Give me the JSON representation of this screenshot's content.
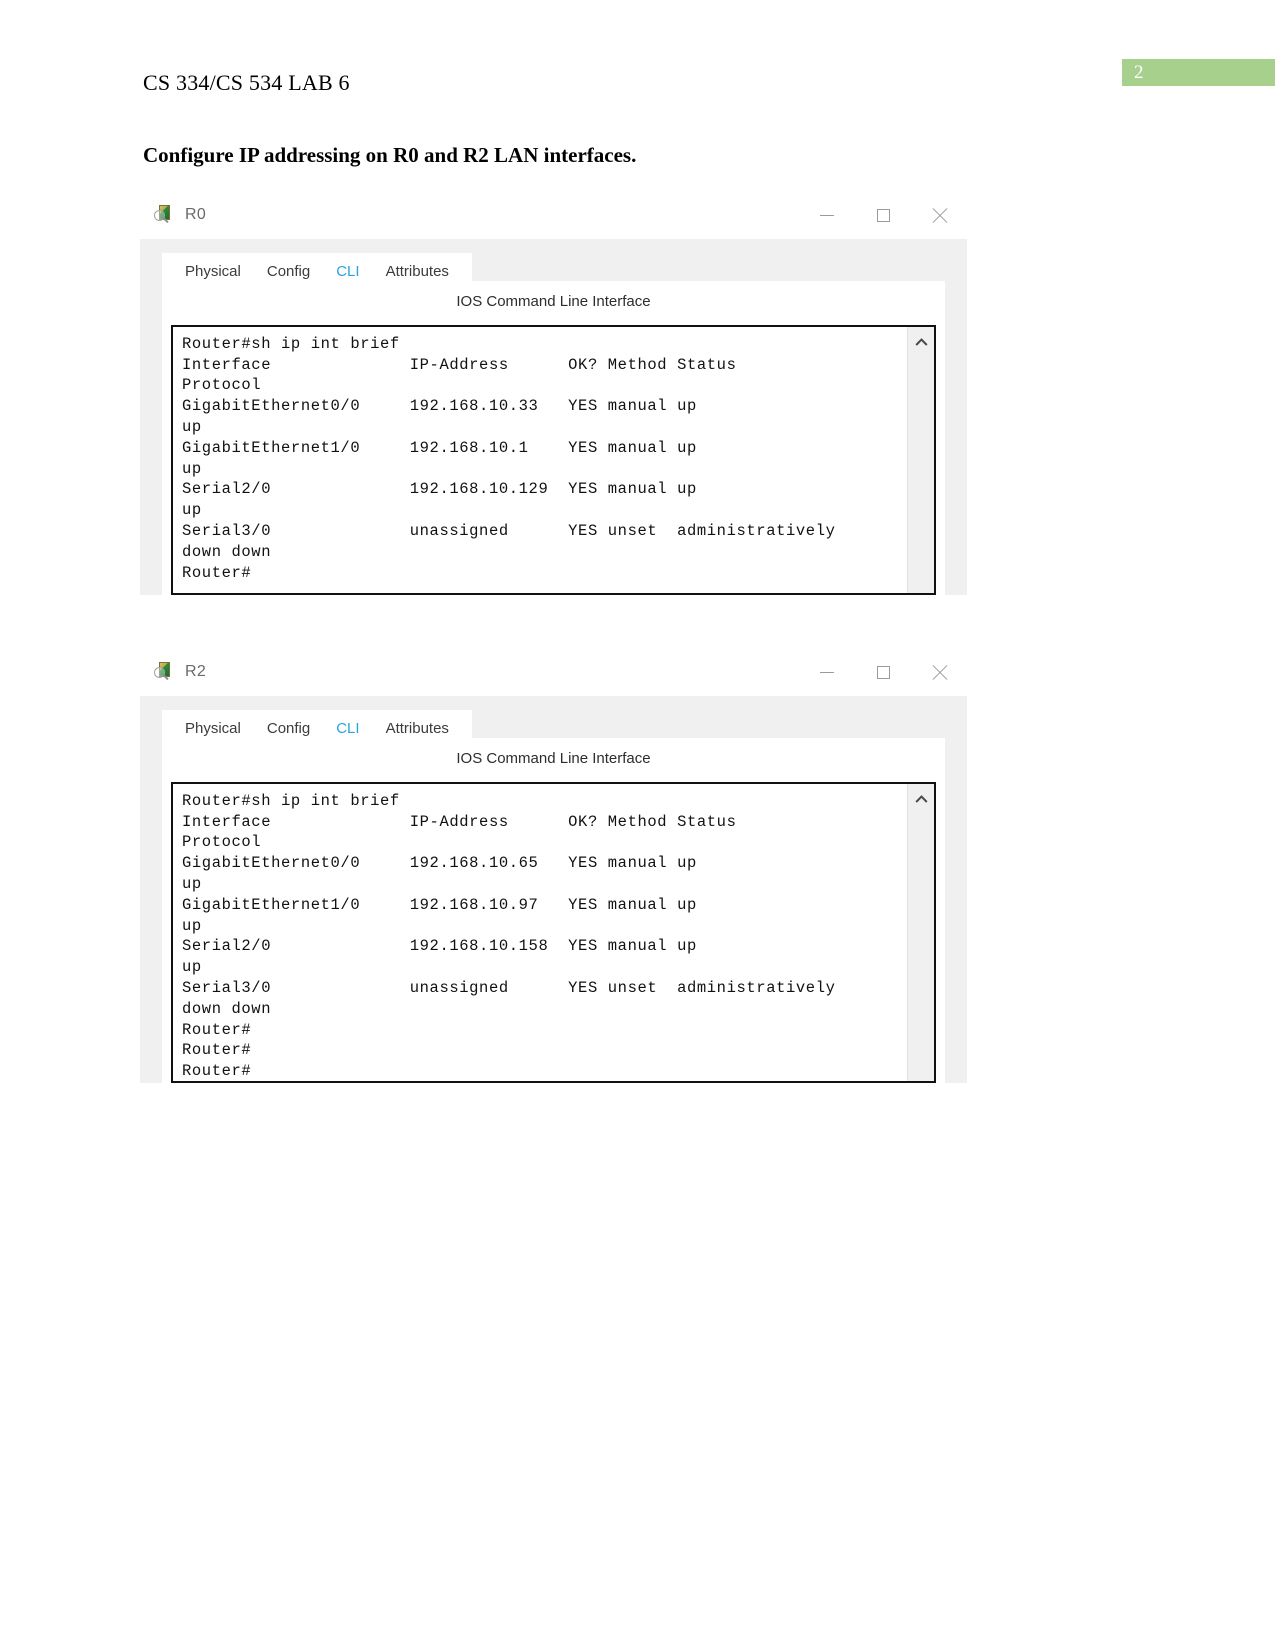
{
  "page": {
    "number": "2",
    "badge_color": "#a8d08d",
    "header": "CS 334/CS 534 LAB 6",
    "heading": "Configure IP addressing on R0 and R2 LAN interfaces."
  },
  "accent_color": "#1f9fdb",
  "windows": [
    {
      "title": "R0",
      "icon": "packet-tracer-device-icon",
      "controls": {
        "minimize": "minimize-icon",
        "maximize": "maximize-icon",
        "close": "close-icon"
      },
      "tabs": [
        {
          "label": "Physical",
          "active": false
        },
        {
          "label": "Config",
          "active": false
        },
        {
          "label": "CLI",
          "active": true
        },
        {
          "label": "Attributes",
          "active": false
        }
      ],
      "cli_caption": "IOS Command Line Interface",
      "cli_text": "Router#\nRouter#sh ip int brief\nInterface              IP-Address      OK? Method Status\nProtocol\nGigabitEthernet0/0     192.168.10.33   YES manual up\nup\nGigabitEthernet1/0     192.168.10.1    YES manual up\nup\nSerial2/0              192.168.10.129  YES manual up\nup\nSerial3/0              unassigned      YES unset  administratively\ndown down\nRouter#",
      "scrollbar": "vertical-scrollbar"
    },
    {
      "title": "R2",
      "icon": "packet-tracer-device-icon",
      "controls": {
        "minimize": "minimize-icon",
        "maximize": "maximize-icon",
        "close": "close-icon"
      },
      "tabs": [
        {
          "label": "Physical",
          "active": false
        },
        {
          "label": "Config",
          "active": false
        },
        {
          "label": "CLI",
          "active": true
        },
        {
          "label": "Attributes",
          "active": false
        }
      ],
      "cli_caption": "IOS Command Line Interface",
      "cli_text": "Router#\nRouter#sh ip int brief\nInterface              IP-Address      OK? Method Status\nProtocol\nGigabitEthernet0/0     192.168.10.65   YES manual up\nup\nGigabitEthernet1/0     192.168.10.97   YES manual up\nup\nSerial2/0              192.168.10.158  YES manual up\nup\nSerial3/0              unassigned      YES unset  administratively\ndown down\nRouter#\nRouter#\nRouter#",
      "scrollbar": "vertical-scrollbar"
    }
  ]
}
